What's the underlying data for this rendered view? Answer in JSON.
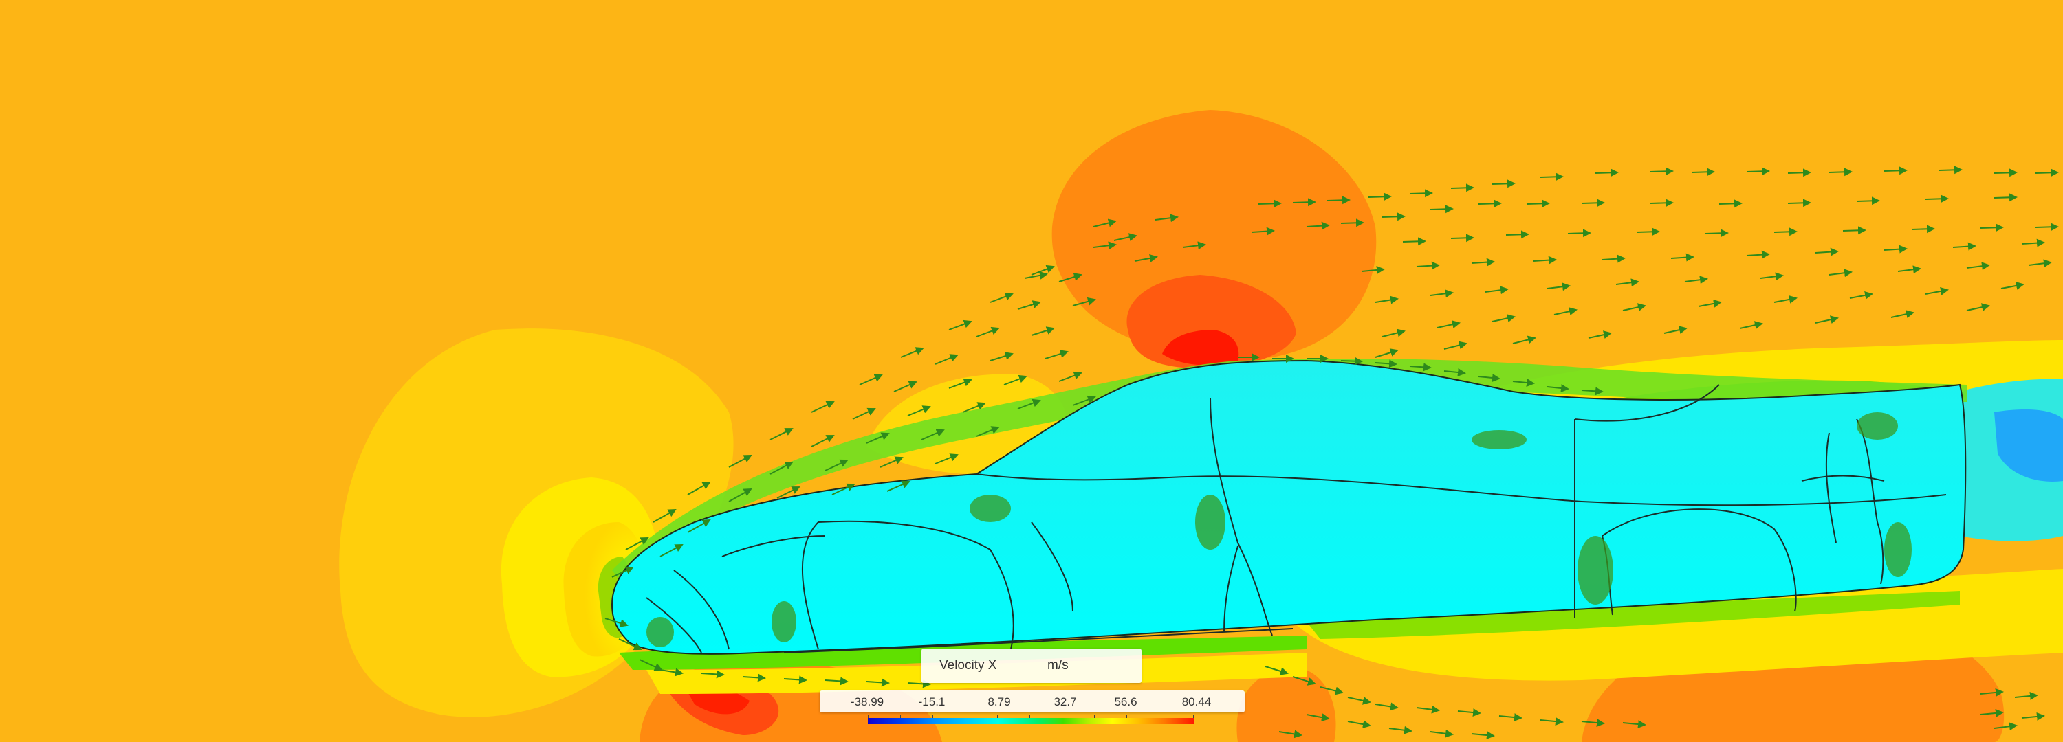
{
  "viewer": {
    "scene": "vehicle-external-aerodynamics",
    "background_color": "#FDB515",
    "field_colors": {
      "low": "#1000D0",
      "body_surface": "#00FFFF",
      "mid": "#00F070",
      "neutral": "#FDB515",
      "high": "#FF1800"
    }
  },
  "legend": {
    "field_name": "Velocity X",
    "unit": "m/s",
    "tick_labels": [
      "-38.99",
      "-15.1",
      "8.79",
      "32.7",
      "56.6",
      "80.44"
    ]
  }
}
